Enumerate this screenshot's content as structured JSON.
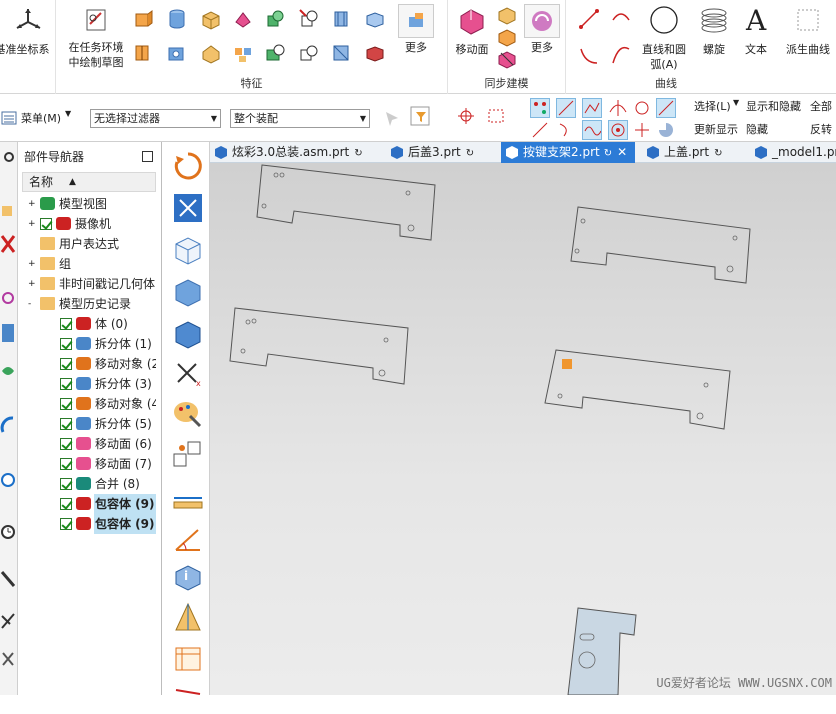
{
  "ribbon": {
    "csys_label": "基准坐标系",
    "sketch_label_line1": "在任务环境",
    "sketch_label_line2": "中绘制草图",
    "more1": "更多",
    "feature_group": "特征",
    "move_face": "移动面",
    "more2": "更多",
    "sync_group": "同步建模",
    "line_arc_line1": "直线和圆",
    "line_arc_line2": "弧(A)",
    "helix": "螺旋",
    "text": "文本",
    "derived_curve": "派生曲线",
    "curve_group": "曲线"
  },
  "toolbar": {
    "menu_label": "菜单(M)",
    "filter_value": "无选择过滤器",
    "assembly_value": "整个装配",
    "select_label": "选择(L)",
    "show_hide": "显示和隐藏",
    "all": "全部",
    "update_display": "更新显示",
    "hide": "隐藏",
    "reverse": "反转"
  },
  "navigator": {
    "title": "部件导航器",
    "column_name": "名称",
    "rows": [
      {
        "label": "模型视图"
      },
      {
        "label": "摄像机"
      },
      {
        "label": "用户表达式"
      },
      {
        "label": "组"
      },
      {
        "label": "非时间戳记几何体"
      },
      {
        "label": "模型历史记录"
      },
      {
        "label": "体 (0)"
      },
      {
        "label": "拆分体 (1)"
      },
      {
        "label": "移动对象 (2"
      },
      {
        "label": "拆分体 (3)"
      },
      {
        "label": "移动对象 (4"
      },
      {
        "label": "拆分体 (5)"
      },
      {
        "label": "移动面 (6)"
      },
      {
        "label": "移动面 (7)"
      },
      {
        "label": "合并 (8)"
      },
      {
        "label": "包容体 (9)"
      },
      {
        "label": "包容体 (9)"
      }
    ]
  },
  "tabs": [
    {
      "label": "炫彩3.0总装.asm.prt"
    },
    {
      "label": "后盖3.prt"
    },
    {
      "label": "按键支架2.prt"
    },
    {
      "label": "上盖.prt"
    },
    {
      "label": "_model1.pr"
    }
  ],
  "watermark": "UG爱好者论坛 WWW.UGSNX.COM",
  "colors": {
    "active_tab": "#2c7bd6",
    "highlight": "#bfe1f3",
    "accent_orange": "#f0962e"
  }
}
